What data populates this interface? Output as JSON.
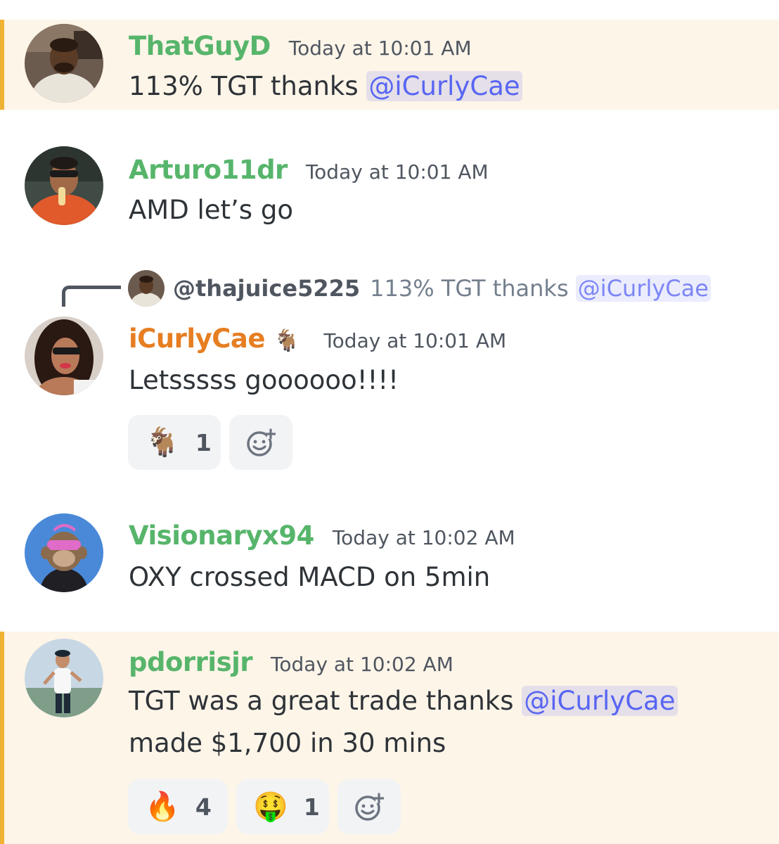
{
  "colors": {
    "username_green": "#57b56b",
    "username_orange": "#e67e22",
    "mention": "#5865f2",
    "highlight_bg": "#fdf5e8",
    "highlight_bar": "#f0b232"
  },
  "messages": [
    {
      "username": "ThatGuyD",
      "timestamp": "Today at 10:01 AM",
      "text_before": "113% TGT thanks ",
      "mention": "@iCurlyCae"
    },
    {
      "username": "Arturo11dr",
      "timestamp": "Today at 10:01 AM",
      "text": "AMD let’s go"
    },
    {
      "reply": {
        "user": "@thajuice5225",
        "text_before": "113% TGT thanks ",
        "mention": "@iCurlyCae"
      },
      "username": "iCurlyCae",
      "badge_icon": "goat-emoji",
      "badge": "🐐",
      "timestamp": "Today at 10:01 AM",
      "text": "Letsssss goooooo!!!!",
      "reactions": [
        {
          "icon": "goat-emoji",
          "emoji": "🐐",
          "count": "1"
        }
      ]
    },
    {
      "username": "Visionaryx94",
      "timestamp": "Today at 10:02 AM",
      "text": "OXY crossed MACD on 5min"
    },
    {
      "username": "pdorrisjr",
      "timestamp": "Today at 10:02 AM",
      "text_before": "TGT was a great trade thanks ",
      "mention": "@iCurlyCae",
      "text_line2": "made $1,700 in 30 mins",
      "reactions": [
        {
          "icon": "fire-emoji",
          "emoji": "🔥",
          "count": "4"
        },
        {
          "icon": "money-mouth-emoji",
          "emoji": "🤑",
          "count": "1"
        }
      ]
    }
  ]
}
